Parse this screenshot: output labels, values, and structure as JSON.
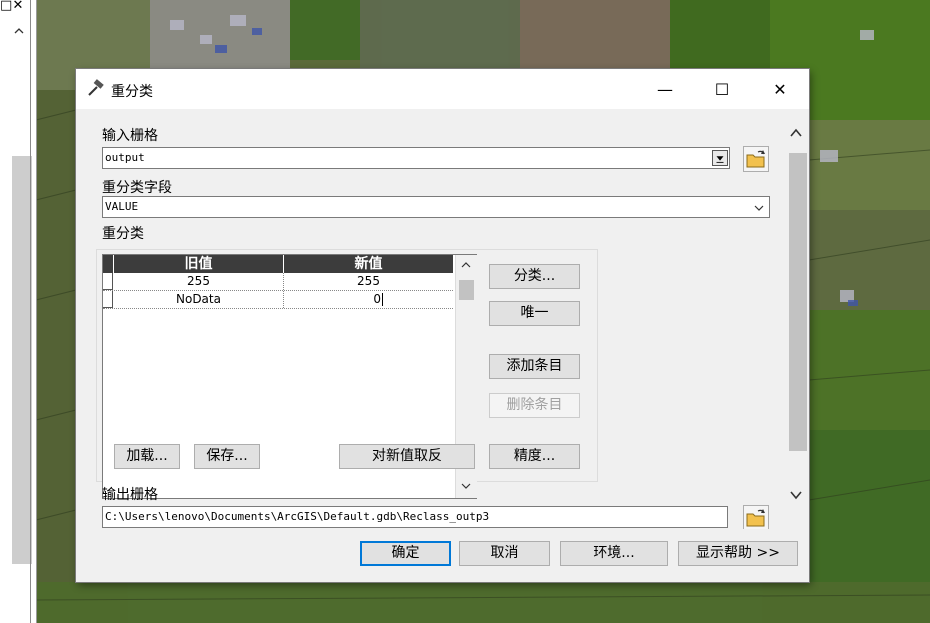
{
  "left_panel": {
    "minimize_glyph": "□",
    "close_glyph": "✕"
  },
  "dialog": {
    "title": "重分类",
    "window_controls": {
      "minimize": "—",
      "maximize": "☐",
      "close": "✕"
    },
    "input_raster": {
      "label": "输入栅格",
      "value": "output"
    },
    "reclass_field": {
      "label": "重分类字段",
      "value": "VALUE"
    },
    "reclassification": {
      "label": "重分类",
      "columns": [
        "旧值",
        "新值"
      ],
      "rows": [
        {
          "old": "255",
          "new": "255"
        },
        {
          "old": "NoData",
          "new": "0"
        }
      ]
    },
    "side_buttons": {
      "classify": "分类...",
      "unique": "唯一",
      "add_entry": "添加条目",
      "delete_entry": "删除条目"
    },
    "bottom_buttons": {
      "load": "加载...",
      "save": "保存...",
      "reverse": "对新值取反",
      "precision": "精度..."
    },
    "output_raster": {
      "label": "输出栅格",
      "value": "C:\\Users\\lenovo\\Documents\\ArcGIS\\Default.gdb\\Reclass_outp3"
    },
    "footer_buttons": {
      "ok": "确定",
      "cancel": "取消",
      "env": "环境...",
      "help": "显示帮助 >>"
    }
  }
}
